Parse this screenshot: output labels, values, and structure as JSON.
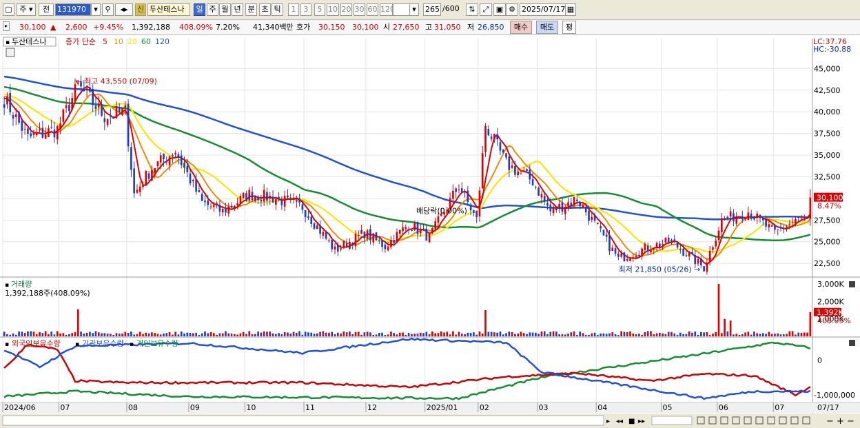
{
  "toolbar": {
    "market": "주",
    "prev": "전",
    "code": "131970",
    "badge": "신",
    "stock_name": "두산테스나",
    "periods": [
      "일",
      "주",
      "월",
      "년",
      "분",
      "초",
      "틱"
    ],
    "intervals": [
      "1",
      "3",
      "5",
      "10",
      "20",
      "30",
      "60",
      "120"
    ],
    "count": "265",
    "count_total": "/600",
    "date": "2025/07/17"
  },
  "quote": {
    "price": "30,100",
    "change": "2,600",
    "change_pct": "+9.45%",
    "volume": "1,392,188",
    "volume_pct": "408.09%",
    "turnover": "7.20%",
    "amount": "41,340백만",
    "ask_label": "호가",
    "ask": "30,150",
    "bid": "30,100",
    "open_label": "시",
    "open": "27,650",
    "high_label": "고",
    "high": "31,050",
    "low_label": "저",
    "low": "26,850",
    "buy": "매수",
    "sell": "매도",
    "eval": "평"
  },
  "colors": {
    "candle_up": "#e00000",
    "candle_down": "#1a3fd0",
    "ma5": "#e00000",
    "ma10": "#f08c00",
    "ma20": "#ffe600",
    "ma60": "#109030",
    "ma120": "#2050e0",
    "foreign": "#d00000",
    "institution": "#2050e0",
    "individual": "#109030"
  },
  "chart_data": [
    {
      "type": "candlestick",
      "legend": {
        "name": "두산테스나",
        "label": "종가 단순",
        "ma": [
          "5",
          "10",
          "20",
          "60",
          "120"
        ]
      },
      "ylim": [
        21000,
        47500
      ],
      "yticks": [
        "45,000",
        "42,500",
        "40,000",
        "37,500",
        "35,000",
        "32,500",
        "30,000",
        "27,500",
        "25,000",
        "22,500"
      ],
      "lc_label": "LC:37.76",
      "hc_label": "HC:-30.88",
      "last_price_label": "30,100",
      "last_pct_label": "8.47%",
      "annotations": {
        "high": "최고 43,550 (07/09)",
        "low": "최저 21,850 (05/26)",
        "dividend": "배당락(0.00%)"
      },
      "x_labels": [
        "2024/06",
        "07",
        "08",
        "09",
        "10",
        "11",
        "12",
        "2025/01",
        "02",
        "03",
        "04",
        "05",
        "06",
        "07"
      ],
      "x_end_label": "07/17",
      "close_anchors": [
        {
          "date": "2024/06/03",
          "close": 41500
        },
        {
          "date": "2024/06/14",
          "close": 37000
        },
        {
          "date": "2024/06/28",
          "close": 38000
        },
        {
          "date": "2024/07/09",
          "close": 43000
        },
        {
          "date": "2024/07/22",
          "close": 39500
        },
        {
          "date": "2024/07/31",
          "close": 40000
        },
        {
          "date": "2024/08/05",
          "close": 30500
        },
        {
          "date": "2024/08/13",
          "close": 33500
        },
        {
          "date": "2024/08/26",
          "close": 35500
        },
        {
          "date": "2024/09/06",
          "close": 29500
        },
        {
          "date": "2024/09/20",
          "close": 28500
        },
        {
          "date": "2024/10/04",
          "close": 30500
        },
        {
          "date": "2024/10/18",
          "close": 30000
        },
        {
          "date": "2024/10/31",
          "close": 29000
        },
        {
          "date": "2024/11/15",
          "close": 24000
        },
        {
          "date": "2024/11/29",
          "close": 26000
        },
        {
          "date": "2024/12/10",
          "close": 24500
        },
        {
          "date": "2024/12/20",
          "close": 27000
        },
        {
          "date": "2025/01/03",
          "close": 25500
        },
        {
          "date": "2025/01/17",
          "close": 31500
        },
        {
          "date": "2025/01/31",
          "close": 27500
        },
        {
          "date": "2025/02/05",
          "close": 38500
        },
        {
          "date": "2025/02/14",
          "close": 34000
        },
        {
          "date": "2025/02/27",
          "close": 32000
        },
        {
          "date": "2025/03/10",
          "close": 28500
        },
        {
          "date": "2025/03/21",
          "close": 30000
        },
        {
          "date": "2025/04/01",
          "close": 26500
        },
        {
          "date": "2025/04/10",
          "close": 23000
        },
        {
          "date": "2025/04/25",
          "close": 24500
        },
        {
          "date": "2025/05/09",
          "close": 25000
        },
        {
          "date": "2025/05/26",
          "close": 22000
        },
        {
          "date": "2025/06/04",
          "close": 27500
        },
        {
          "date": "2025/06/18",
          "close": 28500
        },
        {
          "date": "2025/07/01",
          "close": 26000
        },
        {
          "date": "2025/07/10",
          "close": 27500
        },
        {
          "date": "2025/07/16",
          "close": 27500
        },
        {
          "date": "2025/07/17",
          "close": 30100
        }
      ]
    },
    {
      "type": "bar",
      "title": "거래량",
      "value_label": "1,392,188주(408.09%)",
      "ylim": [
        0,
        3200
      ],
      "unit": "K",
      "yticks": [
        "3,000K",
        "2,000K",
        "1,000K"
      ],
      "last_label": "1,392K",
      "last_pct_label": "408.09%",
      "base_volume_k": 250,
      "spikes": [
        {
          "date": "2024/07/09",
          "volume_k": 1550
        },
        {
          "date": "2025/02/05",
          "volume_k": 1500
        },
        {
          "date": "2025/06/02",
          "volume_k": 3000
        },
        {
          "date": "2025/06/05",
          "volume_k": 1000
        },
        {
          "date": "2025/06/10",
          "volume_k": 900
        },
        {
          "date": "2025/07/17",
          "volume_k": 1392
        }
      ]
    },
    {
      "type": "line",
      "series": [
        {
          "name": "외국인보유수량",
          "key": "foreign"
        },
        {
          "name": "기관보유수량",
          "key": "institution"
        },
        {
          "name": "개인보유수량",
          "key": "individual"
        }
      ],
      "ylim": [
        -1200000,
        600000
      ],
      "yticks": [
        "0",
        "-1,000,000"
      ],
      "foreign_anchors": [
        {
          "date": "2024/06/03",
          "value": -250000
        },
        {
          "date": "2024/06/14",
          "value": 450000
        },
        {
          "date": "2024/06/28",
          "value": 300000
        },
        {
          "date": "2024/07/08",
          "value": -600000
        },
        {
          "date": "2024/07/31",
          "value": -650000
        },
        {
          "date": "2024/10/31",
          "value": -650000
        },
        {
          "date": "2024/12/20",
          "value": -780000
        },
        {
          "date": "2025/02/14",
          "value": -480000
        },
        {
          "date": "2025/03/21",
          "value": -380000
        },
        {
          "date": "2025/04/25",
          "value": -600000
        },
        {
          "date": "2025/05/26",
          "value": -400000
        },
        {
          "date": "2025/06/20",
          "value": -450000
        },
        {
          "date": "2025/07/10",
          "value": -1000000
        },
        {
          "date": "2025/07/17",
          "value": -780000
        }
      ],
      "institution_anchors": [
        {
          "date": "2024/06/03",
          "value": 300000
        },
        {
          "date": "2024/06/20",
          "value": -200000
        },
        {
          "date": "2024/07/08",
          "value": 400000
        },
        {
          "date": "2024/09/02",
          "value": 480000
        },
        {
          "date": "2024/10/31",
          "value": 200000
        },
        {
          "date": "2024/12/20",
          "value": 600000
        },
        {
          "date": "2025/02/14",
          "value": 500000
        },
        {
          "date": "2025/03/05",
          "value": -350000
        },
        {
          "date": "2025/04/10",
          "value": -700000
        },
        {
          "date": "2025/05/26",
          "value": -1100000
        },
        {
          "date": "2025/06/20",
          "value": -900000
        },
        {
          "date": "2025/07/17",
          "value": -900000
        }
      ],
      "individual_anchors": [
        {
          "date": "2024/06/03",
          "value": -1050000
        },
        {
          "date": "2024/07/08",
          "value": -900000
        },
        {
          "date": "2024/08/30",
          "value": -1050000
        },
        {
          "date": "2025/01/17",
          "value": -1100000
        },
        {
          "date": "2025/03/05",
          "value": -500000
        },
        {
          "date": "2025/05/26",
          "value": 180000
        },
        {
          "date": "2025/07/01",
          "value": 500000
        },
        {
          "date": "2025/07/17",
          "value": 350000
        }
      ]
    }
  ],
  "zoom": {
    "minus": "−",
    "plus": "+"
  }
}
